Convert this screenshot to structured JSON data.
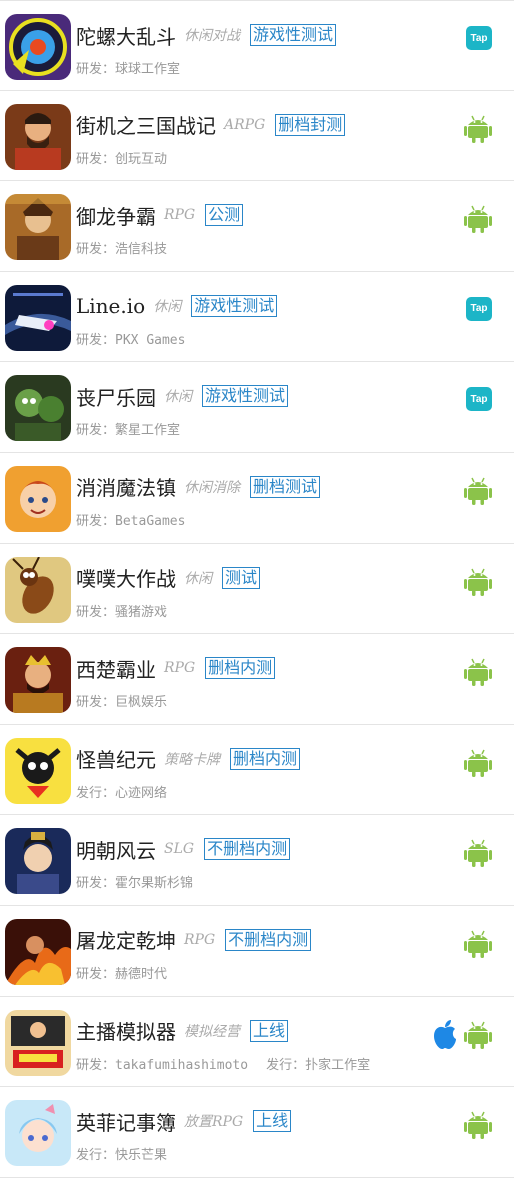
{
  "colors": {
    "badge": "#2a86c8",
    "android": "#8bc34a",
    "apple": "#1e88e5",
    "tap": "#1cb5c7"
  },
  "games": [
    {
      "name": "陀螺大乱斗",
      "genre": "休闲对战",
      "status": "游戏性测试",
      "credit_label": "研发：",
      "credit": "球球工作室",
      "platforms": [
        "tap-icon"
      ],
      "art": "beyblade"
    },
    {
      "name": "街机之三国战记",
      "genre": "ARPG",
      "status": "删档封测",
      "credit_label": "研发：",
      "credit": "创玩互动",
      "platforms": [
        "android-icon"
      ],
      "art": "warrior"
    },
    {
      "name": "御龙争霸",
      "genre": "RPG",
      "status": "公测",
      "credit_label": "研发：",
      "credit": "浩信科技",
      "platforms": [
        "android-icon"
      ],
      "art": "general"
    },
    {
      "name": "Line.io",
      "genre": "休闲",
      "status": "游戏性测试",
      "credit_label": "研发：",
      "credit": "PKX Games",
      "platforms": [
        "tap-icon"
      ],
      "art": "ship"
    },
    {
      "name": "丧尸乐园",
      "genre": "休闲",
      "status": "游戏性测试",
      "credit_label": "研发：",
      "credit": "繁星工作室",
      "platforms": [
        "tap-icon"
      ],
      "art": "zombie"
    },
    {
      "name": "消消魔法镇",
      "genre": "休闲消除",
      "status": "删档测试",
      "credit_label": "研发：",
      "credit": "BetaGames",
      "platforms": [
        "android-icon"
      ],
      "art": "boy"
    },
    {
      "name": "噗噗大作战",
      "genre": "休闲",
      "status": "测试",
      "credit_label": "研发：",
      "credit": "骚猪游戏",
      "platforms": [
        "android-icon"
      ],
      "art": "bug"
    },
    {
      "name": "西楚霸业",
      "genre": "RPG",
      "status": "删档内测",
      "credit_label": "研发：",
      "credit": "巨枫娱乐",
      "platforms": [
        "android-icon"
      ],
      "art": "king"
    },
    {
      "name": "怪兽纪元",
      "genre": "策略卡牌",
      "status": "删档内测",
      "credit_label": "发行：",
      "credit": "心迹网络",
      "platforms": [
        "android-icon"
      ],
      "art": "monster"
    },
    {
      "name": "明朝风云",
      "genre": "SLG",
      "status": "不删档内测",
      "credit_label": "研发：",
      "credit": "霍尔果斯杉锦",
      "platforms": [
        "android-icon"
      ],
      "art": "prince"
    },
    {
      "name": "屠龙定乾坤",
      "genre": "RPG",
      "status": "不删档内测",
      "credit_label": "研发：",
      "credit": "赫德时代",
      "platforms": [
        "android-icon"
      ],
      "art": "fire"
    },
    {
      "name": "主播模拟器",
      "genre": "模拟经营",
      "status": "上线",
      "credit_label": "研发：",
      "credit": "takafumihashimoto",
      "credit2_label": "发行：",
      "credit2": "扑家工作室",
      "platforms": [
        "apple-icon",
        "android-icon"
      ],
      "art": "streamer"
    },
    {
      "name": "英菲记事簿",
      "genre": "放置RPG",
      "status": "上线",
      "credit_label": "发行：",
      "credit": "快乐芒果",
      "platforms": [
        "android-icon"
      ],
      "art": "girl"
    }
  ],
  "tap_label": "Tap"
}
